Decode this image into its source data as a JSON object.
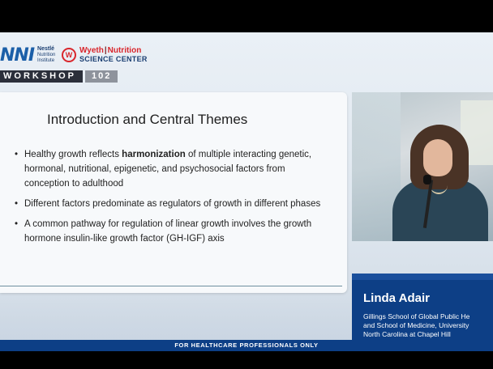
{
  "header": {
    "nni_mark": "NNI",
    "nni_lines": [
      "Nestlé",
      "Nutrition",
      "Institute"
    ],
    "wyeth_seal": "W",
    "wyeth_brand": "Wyeth",
    "wyeth_sep": "|",
    "wyeth_nutrition": "Nutrition",
    "wyeth_sub": "SCIENCE CENTER",
    "workshop_label": "WORKSHOP",
    "workshop_number": "102"
  },
  "slide": {
    "title": "Introduction and Central Themes",
    "bullets": [
      {
        "before": "Healthy growth reflects ",
        "bold": "harmonization",
        "after": " of multiple interacting genetic, hormonal, nutritional, epigenetic, and psychosocial factors from conception to adulthood"
      },
      {
        "text": "Different factors predominate as regulators of growth in different phases"
      },
      {
        "text": "A common pathway for regulation of linear growth involves the growth hormone insulin-like growth factor (GH-IGF) axis"
      }
    ]
  },
  "speaker": {
    "name": "Linda Adair",
    "affiliation_lines": [
      "Gillings School of Global Public He",
      "and School of Medicine, University",
      "North Carolina at Chapel Hill"
    ]
  },
  "footer": {
    "text": "FOR HEALTHCARE PROFESSIONALS ONLY"
  },
  "colors": {
    "brand_blue": "#0d3f86",
    "wyeth_red": "#d9262c",
    "workshop_dark": "#2b2f3a"
  }
}
